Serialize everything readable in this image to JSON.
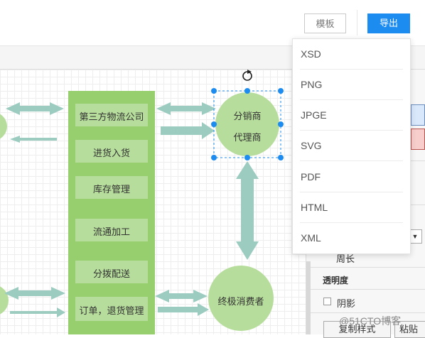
{
  "toolbar": {
    "template_label": "模板",
    "export_label": "导出"
  },
  "export_menu": {
    "items": [
      "XSD",
      "PNG",
      "JPGE",
      "SVG",
      "PDF",
      "HTML",
      "XML"
    ]
  },
  "diagram": {
    "center_column": [
      "第三方物流公司",
      "进货入货",
      "库存管理",
      "流通加工",
      "分拨配送",
      "订单，退货管理"
    ],
    "distributor": [
      "分销商",
      "代理商"
    ],
    "consumer": "终极消费者"
  },
  "right_panel": {
    "perimeter_label": "周长",
    "opacity_label": "透明度",
    "shadow_label": "阴影",
    "copy_style_label": "复制样式",
    "paste_label": "粘贴"
  },
  "watermark": "@51CTO博客",
  "colors": {
    "accent": "#1d8cf0",
    "shape_green": "#97cf6f",
    "box_green": "#b6dd9b",
    "arrow": "#9ccbc0",
    "selection": "#1d8cf0"
  }
}
